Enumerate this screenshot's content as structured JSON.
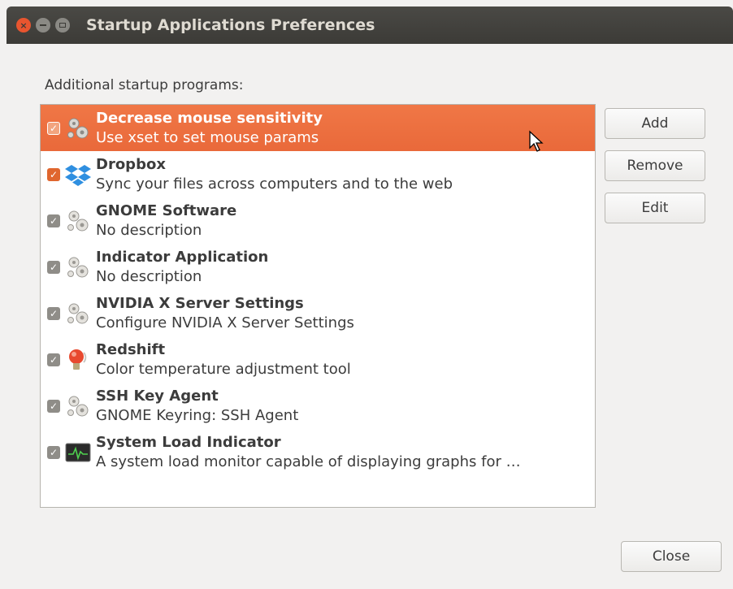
{
  "window": {
    "title": "Startup Applications Preferences",
    "close_glyph": "×"
  },
  "list": {
    "label": "Additional startup programs:",
    "items": [
      {
        "name": "Decrease mouse sensitivity",
        "description": "Use xset to set mouse params",
        "checked": true,
        "selected": true,
        "icon": "gears-icon"
      },
      {
        "name": "Dropbox",
        "description": "Sync your files across computers and to the web",
        "checked": true,
        "selected": false,
        "icon": "dropbox-icon"
      },
      {
        "name": "GNOME Software",
        "description": "No description",
        "checked": true,
        "selected": false,
        "icon": "gears-icon"
      },
      {
        "name": "Indicator Application",
        "description": "No description",
        "checked": true,
        "selected": false,
        "icon": "gears-icon"
      },
      {
        "name": "NVIDIA X Server Settings",
        "description": "Configure NVIDIA X Server Settings",
        "checked": true,
        "selected": false,
        "icon": "gears-icon"
      },
      {
        "name": "Redshift",
        "description": "Color temperature adjustment tool",
        "checked": true,
        "selected": false,
        "icon": "redshift-bulb-icon"
      },
      {
        "name": "SSH Key Agent",
        "description": "GNOME Keyring: SSH Agent",
        "checked": true,
        "selected": false,
        "icon": "gears-icon"
      },
      {
        "name": "System Load Indicator",
        "description": "A system load monitor capable of displaying graphs for …",
        "checked": true,
        "selected": false,
        "icon": "system-monitor-icon"
      }
    ]
  },
  "buttons": {
    "add": "Add",
    "remove": "Remove",
    "edit": "Edit",
    "close": "Close"
  },
  "colors": {
    "selection": "#ef7543",
    "titlebar": "#3c3b37",
    "accent_checkbox": "#e0662e"
  }
}
